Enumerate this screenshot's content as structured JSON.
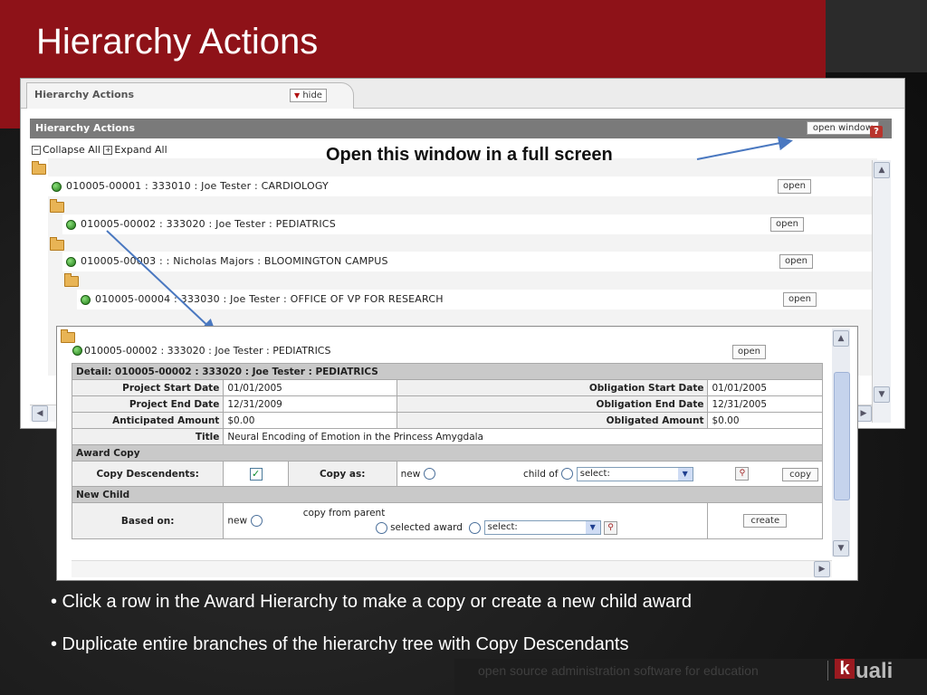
{
  "slide": {
    "title": "Hierarchy Actions",
    "annotation": "Open this window in a full screen",
    "bullets": [
      "• Click a row in the Award Hierarchy to make a copy or create a new child award",
      "• Duplicate entire branches of the hierarchy tree with Copy Descendants"
    ],
    "footer": "open source administration software for education",
    "logo": "uali",
    "logo_mark": "k"
  },
  "app": {
    "tab_label": "Hierarchy Actions",
    "hide_label": "hide",
    "panel_title": "Hierarchy Actions",
    "open_window_label": "open window",
    "help_label": "?",
    "collapse_all": "Collapse All",
    "expand_all": "Expand All",
    "open_label": "open",
    "tree": [
      "010005-00001 : 333010 : Joe Tester : CARDIOLOGY",
      "010005-00002 : 333020 : Joe Tester : PEDIATRICS",
      "010005-00003 : : Nicholas Majors : BLOOMINGTON CAMPUS",
      "010005-00004 : 333030 : Joe Tester : OFFICE OF VP FOR RESEARCH"
    ]
  },
  "detail": {
    "node": "010005-00002 : 333020 : Joe Tester : PEDIATRICS",
    "open_label": "open",
    "header": "Detail: 010005-00002 : 333020 : Joe Tester : PEDIATRICS",
    "project_start_label": "Project Start Date",
    "project_start": "01/01/2005",
    "obligation_start_label": "Obligation Start Date",
    "obligation_start": "01/01/2005",
    "project_end_label": "Project End Date",
    "project_end": "12/31/2009",
    "obligation_end_label": "Obligation End Date",
    "obligation_end": "12/31/2005",
    "anticipated_label": "Anticipated Amount",
    "anticipated": "$0.00",
    "obligated_label": "Obligated Amount",
    "obligated": "$0.00",
    "title_label": "Title",
    "title": "Neural Encoding of Emotion in the Princess Amygdala",
    "award_copy_section": "Award Copy",
    "copy_descendents_label": "Copy Descendents:",
    "copy_descendents_checked": true,
    "copy_as_label": "Copy as:",
    "new_label": "new",
    "child_of_label": "child of",
    "select_placeholder": "select:",
    "copy_button": "copy",
    "new_child_section": "New Child",
    "based_on_label": "Based on:",
    "copy_from_parent_label": "copy from parent",
    "selected_award_label": "selected award",
    "create_button": "create"
  },
  "colors": {
    "title_band": "#8e1218",
    "panel_header": "#7a7a7a",
    "section_bg": "#c9c9c9"
  }
}
